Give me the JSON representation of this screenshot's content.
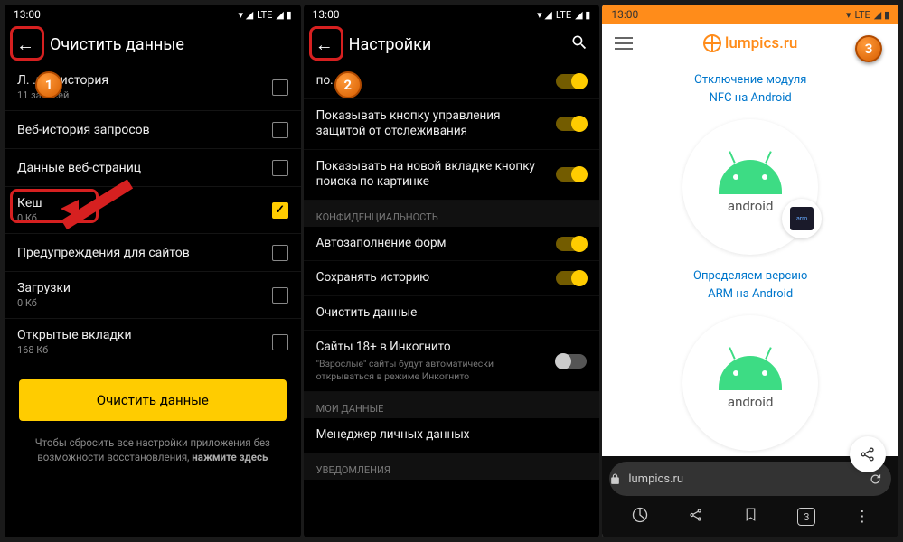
{
  "status": {
    "time": "13:00",
    "net": "LTE",
    "icons": "◢ ▮"
  },
  "screen1": {
    "title": "Очистить данные",
    "items": [
      {
        "label": "Л.           .ная история",
        "sub": "11 записей",
        "checked": false
      },
      {
        "label": "Веб-история запросов",
        "sub": "",
        "checked": false
      },
      {
        "label": "Данные веб-страниц",
        "sub": "",
        "checked": false
      },
      {
        "label": "Кеш",
        "sub": "0 Кб",
        "checked": true
      },
      {
        "label": "Предупреждения для сайтов",
        "sub": "",
        "checked": false
      },
      {
        "label": "Загрузки",
        "sub": "0 Кб",
        "checked": false
      },
      {
        "label": "Открытые вкладки",
        "sub": "168 Кб",
        "checked": false
      }
    ],
    "button": "Очистить данные",
    "hint1": "Чтобы сбросить все настройки приложения без возможности восстановления, ",
    "hint2": "нажмите здесь"
  },
  "screen2": {
    "title": "Настройки",
    "topcut": "по.",
    "items": [
      {
        "label": "Показывать кнопку управления защитой от отслеживания",
        "toggle": "on"
      },
      {
        "label": "Показывать на новой вкладке кнопку поиска по картинке",
        "toggle": "on"
      }
    ],
    "sect1": "КОНФИДЕНЦИАЛЬНОСТЬ",
    "priv": [
      {
        "label": "Автозаполнение форм",
        "toggle": "on"
      },
      {
        "label": "Сохранять историю",
        "toggle": "on"
      },
      {
        "label": "Очистить данные",
        "toggle": ""
      },
      {
        "label": "Сайты 18+ в Инкогнито",
        "sub": "\"Взрослые\" сайты будут автоматически открываться в режиме Инкогнито",
        "toggle": "off"
      }
    ],
    "sect2": "МОИ ДАННЫЕ",
    "mydata": {
      "label": "Менеджер личных данных"
    },
    "sect3": "УВЕДОМЛЕНИЯ"
  },
  "screen3": {
    "logo": "lumpics.ru",
    "link1a": "Отключение модуля",
    "link1b": "NFC на Android",
    "card_label": "android",
    "link2a": "Определяем версию",
    "link2b": "ARM на Android",
    "addr_host": "lumpics.ru",
    "tabcount": "3"
  },
  "badges": {
    "b1": "1",
    "b2": "2",
    "b3": "3"
  }
}
